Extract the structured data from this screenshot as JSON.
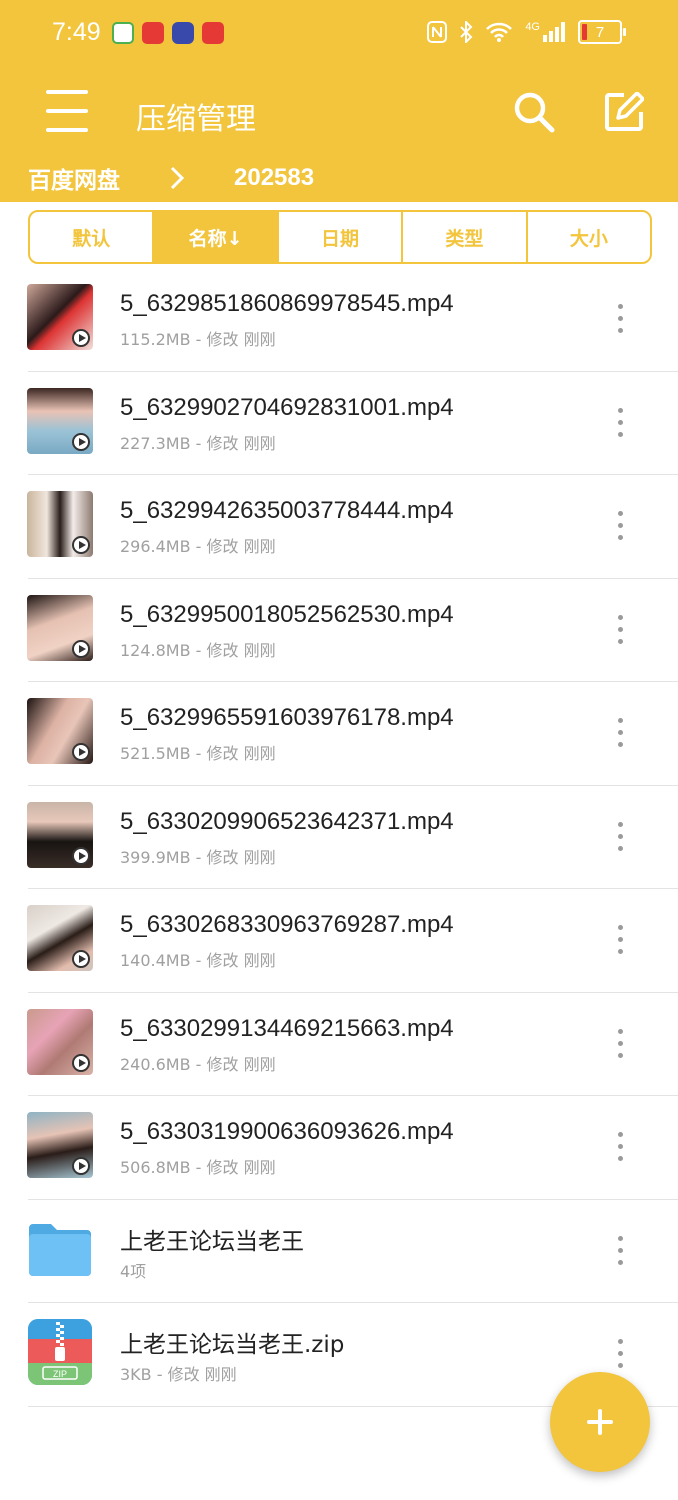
{
  "status_bar": {
    "time": "7:49",
    "battery": "7",
    "network": "4G",
    "icons": [
      "home-app-icon",
      "red-app-icon",
      "camera-app-icon",
      "red-badge-app-icon",
      "nfc-icon",
      "bluetooth-icon",
      "wifi-icon",
      "signal-icon",
      "battery-icon"
    ]
  },
  "app_bar": {
    "title": "压缩管理",
    "icons": [
      "menu-icon",
      "search-icon",
      "edit-icon"
    ]
  },
  "breadcrumb": {
    "root": "百度网盘",
    "current": "202583"
  },
  "sort_tabs": [
    {
      "label": "默认",
      "active": false
    },
    {
      "label": "名称↓",
      "active": true
    },
    {
      "label": "日期",
      "active": false
    },
    {
      "label": "类型",
      "active": false
    },
    {
      "label": "大小",
      "active": false
    }
  ],
  "files": [
    {
      "name": "5_6329851860869978545.mp4",
      "meta": "115.2MB - 修改 刚刚",
      "type": "video"
    },
    {
      "name": "5_6329902704692831001.mp4",
      "meta": "227.3MB - 修改 刚刚",
      "type": "video"
    },
    {
      "name": "5_6329942635003778444.mp4",
      "meta": "296.4MB - 修改 刚刚",
      "type": "video"
    },
    {
      "name": "5_6329950018052562530.mp4",
      "meta": "124.8MB - 修改 刚刚",
      "type": "video"
    },
    {
      "name": "5_6329965591603976178.mp4",
      "meta": "521.5MB - 修改 刚刚",
      "type": "video"
    },
    {
      "name": "5_6330209906523642371.mp4",
      "meta": "399.9MB - 修改 刚刚",
      "type": "video"
    },
    {
      "name": "5_6330268330963769287.mp4",
      "meta": "140.4MB - 修改 刚刚",
      "type": "video"
    },
    {
      "name": "5_6330299134469215663.mp4",
      "meta": "240.6MB - 修改 刚刚",
      "type": "video"
    },
    {
      "name": "5_6330319900636093626.mp4",
      "meta": "506.8MB - 修改 刚刚",
      "type": "video"
    },
    {
      "name": "上老王论坛当老王",
      "meta": "4项",
      "type": "folder"
    },
    {
      "name": "上老王论坛当老王.zip",
      "meta": "3KB - 修改 刚刚",
      "type": "zip"
    }
  ],
  "zip_badge": "ZIP",
  "fab_icon": "plus-icon",
  "colors": {
    "accent": "#F2C53D",
    "folder": "#5BB8F0",
    "meta_text": "#A0A0A0",
    "divider": "#E3E3E3"
  }
}
